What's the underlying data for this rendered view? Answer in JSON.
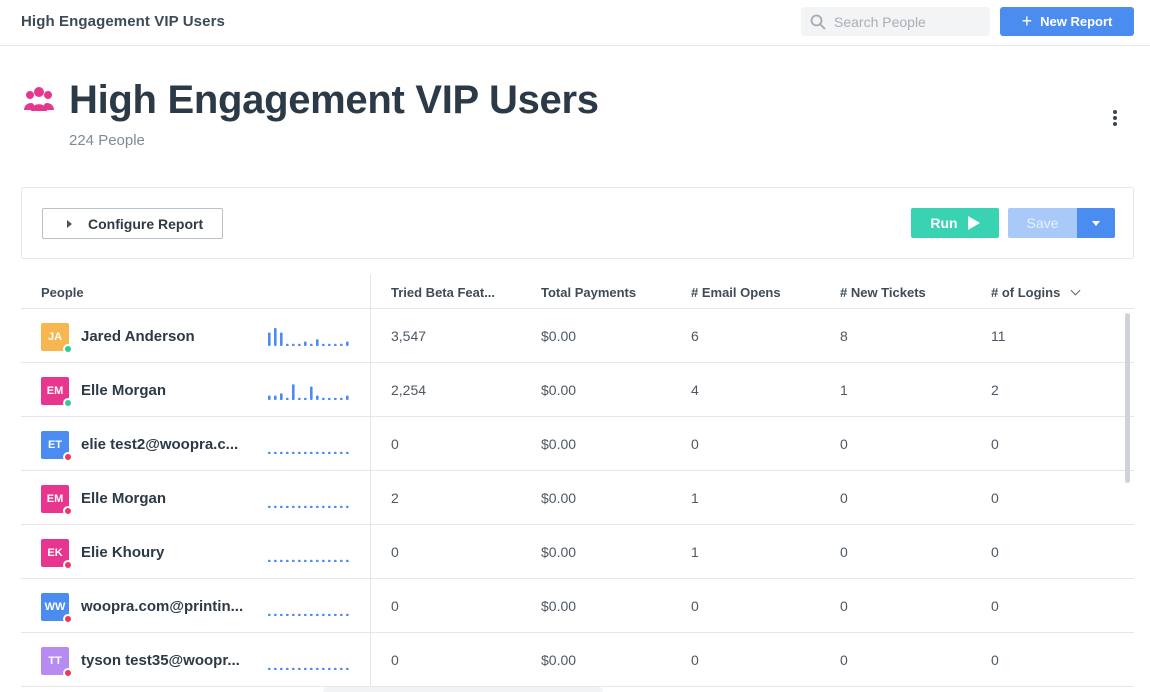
{
  "topbar": {
    "title": "High Engagement VIP Users",
    "search_placeholder": "Search People",
    "new_report_label": "New Report",
    "plus_symbol": "+"
  },
  "header": {
    "title": "High Engagement VIP Users",
    "count": "224 People"
  },
  "config": {
    "configure_label": "Configure Report",
    "run_label": "Run",
    "save_label": "Save"
  },
  "columns": {
    "people": "People",
    "beta": "Tried Beta Feat...",
    "payments": "Total Payments",
    "email_opens": "# Email Opens",
    "tickets": "# New Tickets",
    "logins": "# of Logins"
  },
  "colors": {
    "accent": "#4a8cf0",
    "run": "#39d3b4",
    "online": "#2ecc8f",
    "offline": "#f0365a",
    "people_icon": "#e8368f",
    "spark": "#4a8cf0"
  },
  "rows": [
    {
      "initials": "JA",
      "name": "Jared Anderson",
      "avatar_color": "#f7b64f",
      "status": "online",
      "spark": [
        6,
        8,
        6,
        1,
        1,
        1,
        2,
        1,
        3,
        1,
        1,
        1,
        1,
        2
      ],
      "beta": "3,547",
      "payments": "$0.00",
      "email_opens": "6",
      "tickets": "8",
      "logins": "11"
    },
    {
      "initials": "EM",
      "name": "Elle Morgan",
      "avatar_color": "#e8368f",
      "status": "online",
      "spark": [
        2,
        2,
        3,
        1,
        7,
        1,
        1,
        6,
        2,
        1,
        1,
        1,
        1,
        2
      ],
      "beta": "2,254",
      "payments": "$0.00",
      "email_opens": "4",
      "tickets": "1",
      "logins": "2"
    },
    {
      "initials": "ET",
      "name": "elie test2@woopra.c...",
      "avatar_color": "#4a8cf0",
      "status": "offline",
      "spark": [
        1,
        1,
        1,
        1,
        1,
        1,
        1,
        1,
        1,
        1,
        1,
        1,
        1,
        1
      ],
      "beta": "0",
      "payments": "$0.00",
      "email_opens": "0",
      "tickets": "0",
      "logins": "0"
    },
    {
      "initials": "EM",
      "name": "Elle Morgan",
      "avatar_color": "#e8368f",
      "status": "offline",
      "spark": [
        1,
        1,
        1,
        1,
        1,
        1,
        1,
        1,
        1,
        1,
        1,
        1,
        1,
        1
      ],
      "beta": "2",
      "payments": "$0.00",
      "email_opens": "1",
      "tickets": "0",
      "logins": "0"
    },
    {
      "initials": "EK",
      "name": "Elie Khoury",
      "avatar_color": "#e8368f",
      "status": "offline",
      "spark": [
        1,
        1,
        1,
        1,
        1,
        1,
        1,
        1,
        1,
        1,
        1,
        1,
        1,
        1
      ],
      "beta": "0",
      "payments": "$0.00",
      "email_opens": "1",
      "tickets": "0",
      "logins": "0"
    },
    {
      "initials": "WW",
      "name": "woopra.com@printin...",
      "avatar_color": "#4a8cf0",
      "status": "offline",
      "spark": [
        1,
        1,
        1,
        1,
        1,
        1,
        1,
        1,
        1,
        1,
        1,
        1,
        1,
        1
      ],
      "beta": "0",
      "payments": "$0.00",
      "email_opens": "0",
      "tickets": "0",
      "logins": "0"
    },
    {
      "initials": "TT",
      "name": "tyson test35@woopr...",
      "avatar_color": "#b78cf2",
      "status": "offline",
      "spark": [
        1,
        1,
        1,
        1,
        1,
        1,
        1,
        1,
        1,
        1,
        1,
        1,
        1,
        1
      ],
      "beta": "0",
      "payments": "$0.00",
      "email_opens": "0",
      "tickets": "0",
      "logins": "0"
    }
  ]
}
